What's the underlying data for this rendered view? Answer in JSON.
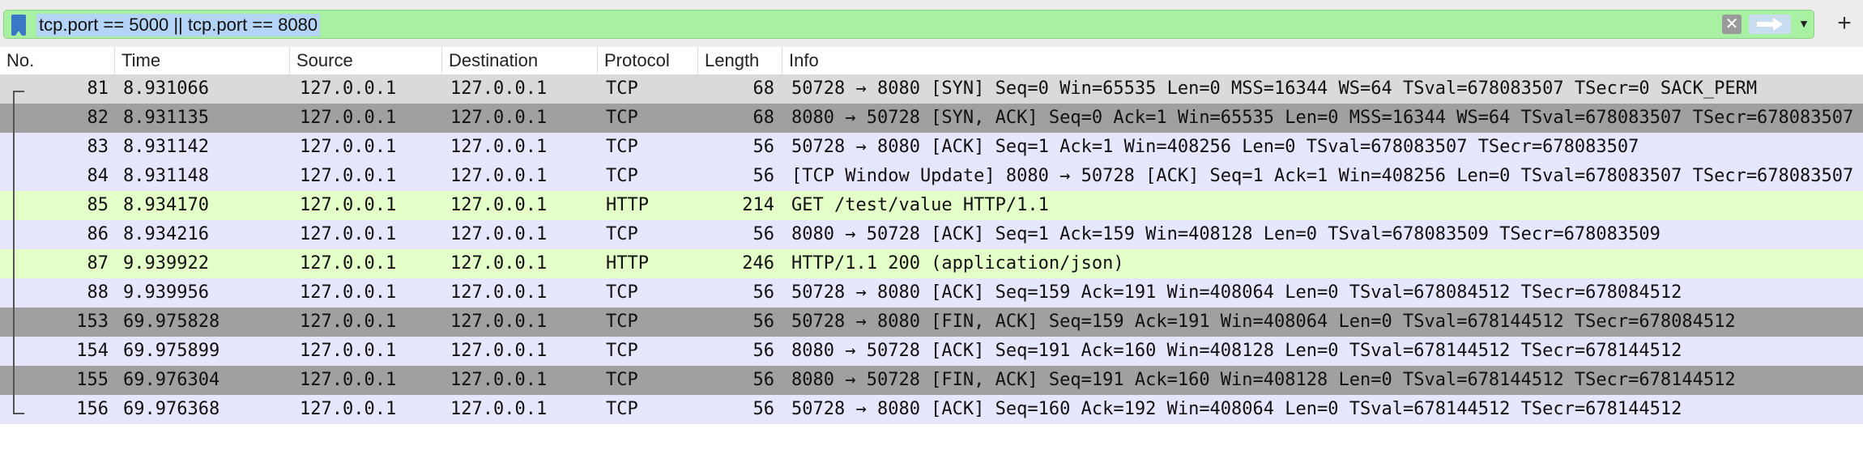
{
  "filter": {
    "value": "tcp.port == 5000 || tcp.port == 8080"
  },
  "icons": {
    "bookmark": "bookmark-icon",
    "clear": "clear-icon",
    "apply": "arrow-right-icon",
    "dropdown": "chevron-down-icon",
    "add": "plus-icon"
  },
  "columns": {
    "no": "No.",
    "time": "Time",
    "source": "Source",
    "destination": "Destination",
    "protocol": "Protocol",
    "length": "Length",
    "info": "Info"
  },
  "colors": {
    "filter_valid": "#a8f0a2",
    "tcp_row": "#e7e6ff",
    "http_row": "#e4ffc7",
    "marked_row": "#a0a0a0"
  },
  "packets": [
    {
      "no": "81",
      "time": "8.931066",
      "source": "127.0.0.1",
      "destination": "127.0.0.1",
      "protocol": "TCP",
      "length": "68",
      "info": "50728 → 8080 [SYN] Seq=0 Win=65535 Len=0 MSS=16344 WS=64 TSval=678083507 TSecr=0 SACK_PERM",
      "style": "first"
    },
    {
      "no": "82",
      "time": "8.931135",
      "source": "127.0.0.1",
      "destination": "127.0.0.1",
      "protocol": "TCP",
      "length": "68",
      "info": "8080 → 50728 [SYN, ACK] Seq=0 Ack=1 Win=65535 Len=0 MSS=16344 WS=64 TSval=678083507 TSecr=678083507",
      "style": "sel"
    },
    {
      "no": "83",
      "time": "8.931142",
      "source": "127.0.0.1",
      "destination": "127.0.0.1",
      "protocol": "TCP",
      "length": "56",
      "info": "50728 → 8080 [ACK] Seq=1 Ack=1 Win=408256 Len=0 TSval=678083507 TSecr=678083507",
      "style": "tcp"
    },
    {
      "no": "84",
      "time": "8.931148",
      "source": "127.0.0.1",
      "destination": "127.0.0.1",
      "protocol": "TCP",
      "length": "56",
      "info": "[TCP Window Update] 8080 → 50728 [ACK] Seq=1 Ack=1 Win=408256 Len=0 TSval=678083507 TSecr=678083507",
      "style": "tcp"
    },
    {
      "no": "85",
      "time": "8.934170",
      "source": "127.0.0.1",
      "destination": "127.0.0.1",
      "protocol": "HTTP",
      "length": "214",
      "info": "GET /test/value HTTP/1.1",
      "style": "http"
    },
    {
      "no": "86",
      "time": "8.934216",
      "source": "127.0.0.1",
      "destination": "127.0.0.1",
      "protocol": "TCP",
      "length": "56",
      "info": "8080 → 50728 [ACK] Seq=1 Ack=159 Win=408128 Len=0 TSval=678083509 TSecr=678083509",
      "style": "tcp"
    },
    {
      "no": "87",
      "time": "9.939922",
      "source": "127.0.0.1",
      "destination": "127.0.0.1",
      "protocol": "HTTP",
      "length": "246",
      "info": "HTTP/1.1 200   (application/json)",
      "style": "http"
    },
    {
      "no": "88",
      "time": "9.939956",
      "source": "127.0.0.1",
      "destination": "127.0.0.1",
      "protocol": "TCP",
      "length": "56",
      "info": "50728 → 8080 [ACK] Seq=159 Ack=191 Win=408064 Len=0 TSval=678084512 TSecr=678084512",
      "style": "tcp"
    },
    {
      "no": "153",
      "time": "69.975828",
      "source": "127.0.0.1",
      "destination": "127.0.0.1",
      "protocol": "TCP",
      "length": "56",
      "info": "50728 → 8080 [FIN, ACK] Seq=159 Ack=191 Win=408064 Len=0 TSval=678144512 TSecr=678084512",
      "style": "sel"
    },
    {
      "no": "154",
      "time": "69.975899",
      "source": "127.0.0.1",
      "destination": "127.0.0.1",
      "protocol": "TCP",
      "length": "56",
      "info": "8080 → 50728 [ACK] Seq=191 Ack=160 Win=408128 Len=0 TSval=678144512 TSecr=678144512",
      "style": "tcp"
    },
    {
      "no": "155",
      "time": "69.976304",
      "source": "127.0.0.1",
      "destination": "127.0.0.1",
      "protocol": "TCP",
      "length": "56",
      "info": "8080 → 50728 [FIN, ACK] Seq=191 Ack=160 Win=408128 Len=0 TSval=678144512 TSecr=678144512",
      "style": "sel"
    },
    {
      "no": "156",
      "time": "69.976368",
      "source": "127.0.0.1",
      "destination": "127.0.0.1",
      "protocol": "TCP",
      "length": "56",
      "info": "50728 → 8080 [ACK] Seq=160 Ack=192 Win=408064 Len=0 TSval=678144512 TSecr=678144512",
      "style": "tcp"
    }
  ]
}
